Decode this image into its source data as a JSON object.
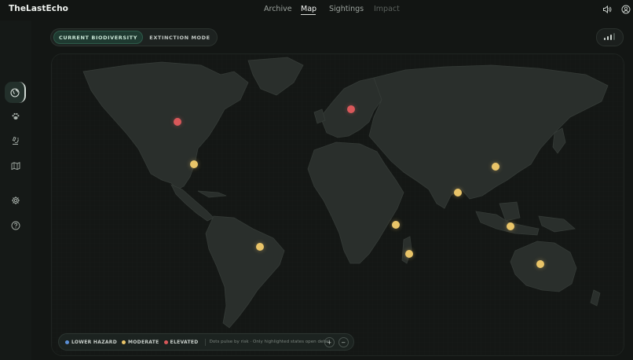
{
  "app": {
    "brand": "TheLastEcho"
  },
  "nav": {
    "items": [
      {
        "label": "Archive",
        "state": "normal"
      },
      {
        "label": "Map",
        "state": "active"
      },
      {
        "label": "Sightings",
        "state": "normal"
      },
      {
        "label": "Impact",
        "state": "disabled"
      }
    ]
  },
  "top_icons": [
    "speaker-icon",
    "user-account-icon"
  ],
  "sidebar": {
    "items": [
      {
        "icon": "globe-icon",
        "active": true
      },
      {
        "icon": "paw-icon",
        "active": false
      },
      {
        "icon": "microscope-icon",
        "active": false
      },
      {
        "icon": "map-layers-icon",
        "active": false
      },
      {
        "icon": "gear-icon",
        "active": false
      },
      {
        "icon": "help-icon",
        "active": false
      }
    ]
  },
  "mode_toggle": {
    "options": [
      "CURRENT BIODIVERSITY",
      "EXTINCTION MODE"
    ],
    "selected": "CURRENT BIODIVERSITY"
  },
  "signal_icon": "signal-strength-icon",
  "markers": [
    {
      "region": "Central Canada",
      "risk": "elevated"
    },
    {
      "region": "Scandinavia",
      "risk": "elevated"
    },
    {
      "region": "Central United States",
      "risk": "moderate"
    },
    {
      "region": "Brazil",
      "risk": "moderate"
    },
    {
      "region": "East Africa",
      "risk": "moderate"
    },
    {
      "region": "Madagascar",
      "risk": "moderate"
    },
    {
      "region": "India",
      "risk": "moderate"
    },
    {
      "region": "China",
      "risk": "moderate"
    },
    {
      "region": "Borneo",
      "risk": "moderate"
    },
    {
      "region": "Australia",
      "risk": "moderate"
    }
  ],
  "legend": {
    "lower_hazard": "LOWER HAZARD",
    "moderate": "MODERATE",
    "elevated": "ELEVATED",
    "note": "Dots pulse by risk · Only highlighted states open detail",
    "zoom_in": "+",
    "zoom_out": "−"
  },
  "colors": {
    "lower_hazard": "#5b8fd6",
    "moderate": "#e9c468",
    "elevated": "#d9585a",
    "accent": "#1f3a31"
  }
}
